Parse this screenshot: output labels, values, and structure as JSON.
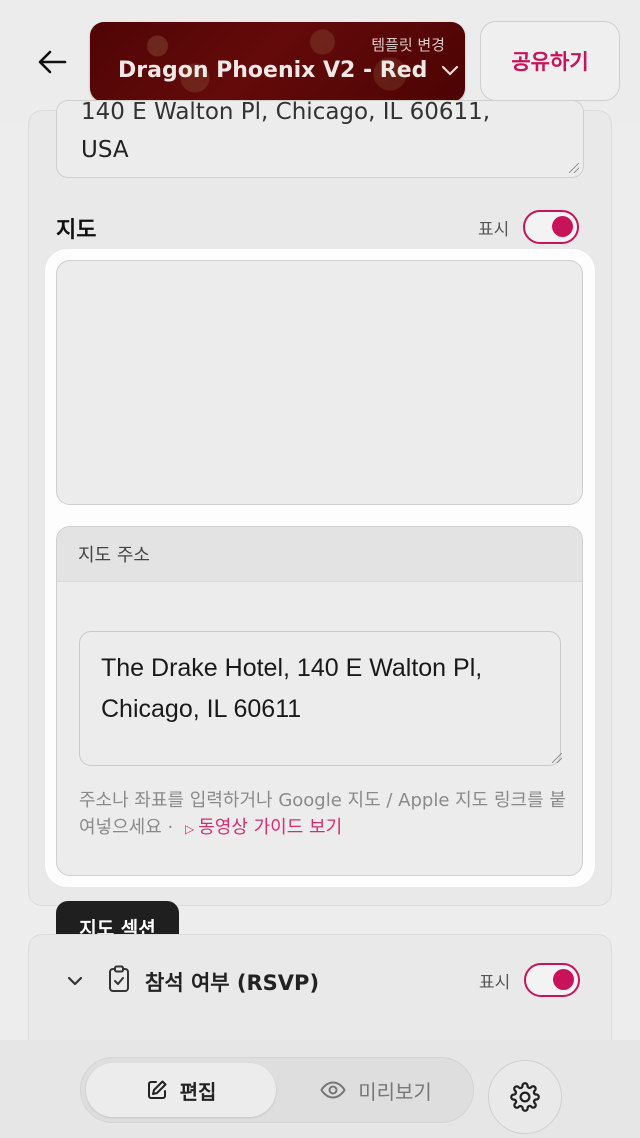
{
  "header": {
    "template_hint": "템플릿 변경",
    "template_name": "Dragon Phoenix V2 - Red",
    "share_label": "공유하기"
  },
  "background_section": {
    "venue_address_partial": "140 E Walton Pl, Chicago, IL 60611,",
    "venue_address_tail": "USA",
    "map_label": "지도",
    "show_label": "표시"
  },
  "map_section": {
    "address_header": "지도 주소",
    "address_value": "The Drake Hotel, 140 E Walton Pl, Chicago, IL 60611",
    "help_text": "주소나 좌표를 입력하거나 Google 지도 / Apple 지도 링크를 붙여넣으세요 · ",
    "guide_link": "동영상 가이드 보기"
  },
  "tooltip": {
    "label": "지도 섹션"
  },
  "rsvp": {
    "title": "참석 여부 (RSVP)",
    "show_label": "표시"
  },
  "bottom_bar": {
    "edit_label": "편집",
    "preview_label": "미리보기"
  },
  "colors": {
    "accent": "#c8135b",
    "link": "#d12f72",
    "template_bg": "#7a1010"
  },
  "icons": [
    "back-arrow-icon",
    "chevron-down-icon",
    "play-icon",
    "clipboard-check-icon",
    "edit-icon",
    "eye-icon",
    "gear-icon"
  ]
}
